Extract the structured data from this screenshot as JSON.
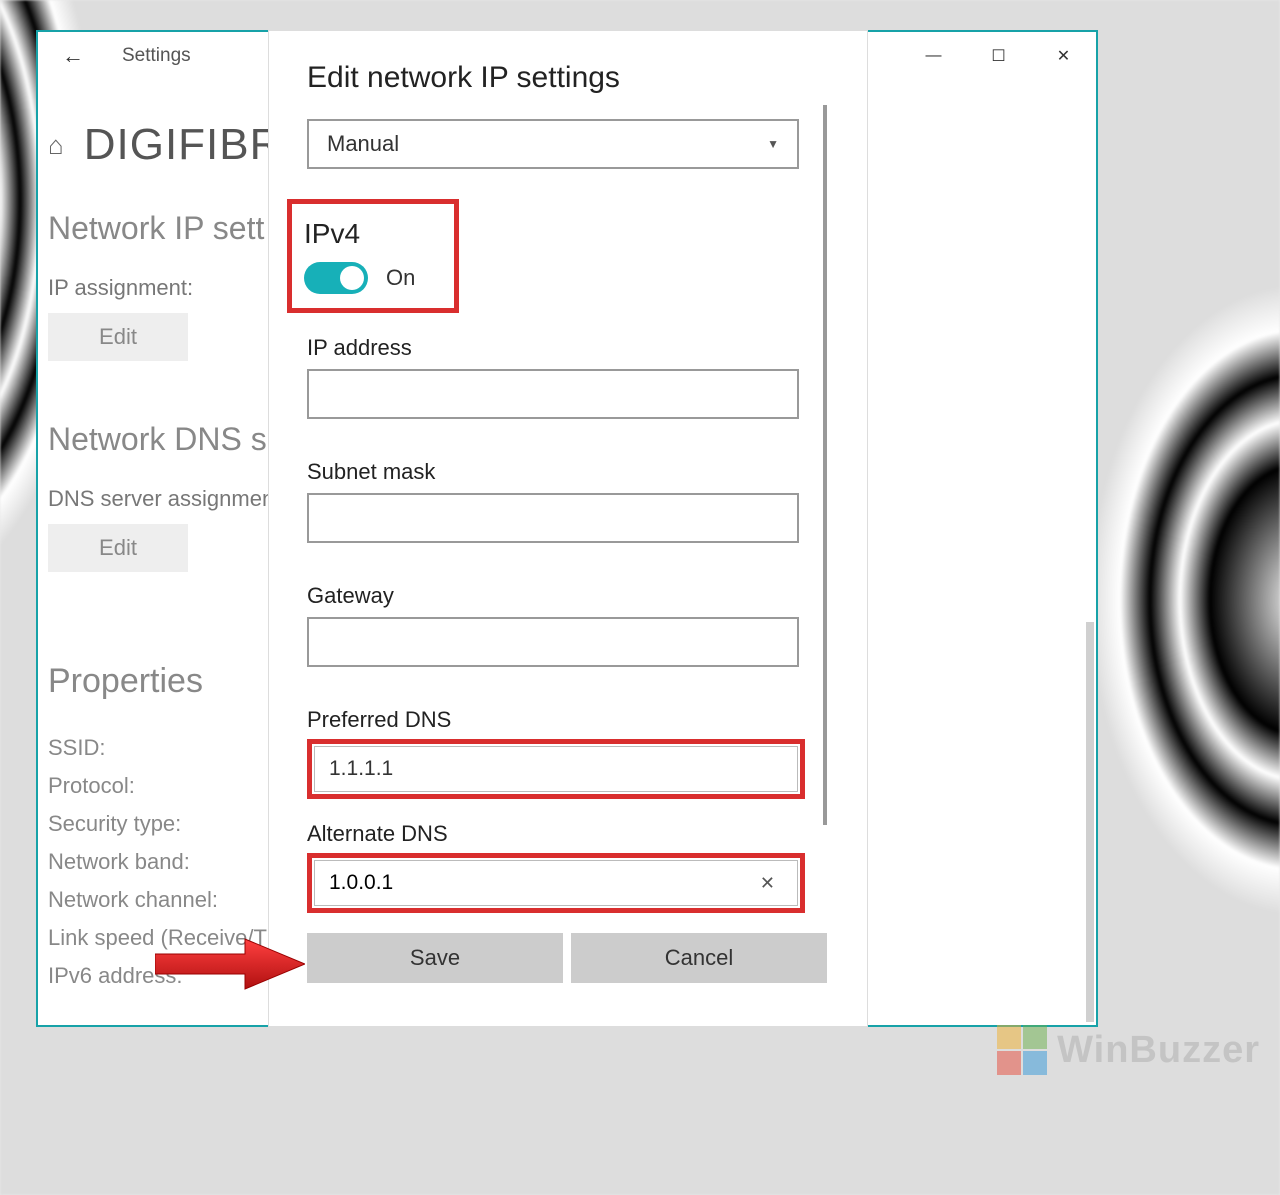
{
  "window": {
    "app_title": "Settings",
    "controls": {
      "minimize": "—",
      "maximize": "☐",
      "close": "✕"
    }
  },
  "page": {
    "home_icon": "⌂",
    "network_name": "DIGIFIBR",
    "section_ip": "Network IP sett",
    "ip_assignment_label": "IP assignment:",
    "edit_ip": "Edit",
    "section_dns": "Network DNS se",
    "dns_assignment_label": "DNS server assignmen",
    "edit_dns": "Edit",
    "properties_heading": "Properties",
    "props": [
      "SSID:",
      "Protocol:",
      "Security type:",
      "Network band:",
      "Network channel:",
      "Link speed (Receive/T",
      "IPv6 address:"
    ]
  },
  "dialog": {
    "title": "Edit network IP settings",
    "mode_select": "Manual",
    "ipv4_label": "IPv4",
    "ipv4_toggle_state": "On",
    "ip_address_label": "IP address",
    "ip_address_value": "",
    "subnet_label": "Subnet mask",
    "subnet_value": "",
    "gateway_label": "Gateway",
    "gateway_value": "",
    "preferred_dns_label": "Preferred DNS",
    "preferred_dns_value": "1.1.1.1",
    "alternate_dns_label": "Alternate DNS",
    "alternate_dns_value": "1.0.0.1",
    "save": "Save",
    "cancel": "Cancel"
  },
  "watermark": "WinBuzzer"
}
